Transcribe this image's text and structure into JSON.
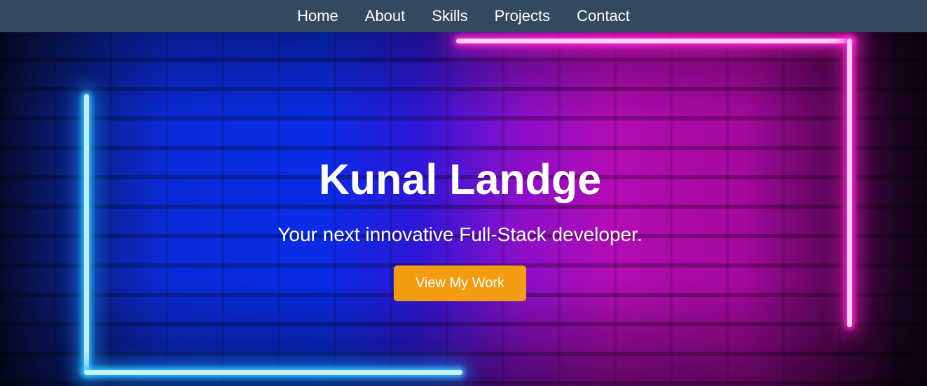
{
  "nav": {
    "items": [
      {
        "label": "Home"
      },
      {
        "label": "About"
      },
      {
        "label": "Skills"
      },
      {
        "label": "Projects"
      },
      {
        "label": "Contact"
      }
    ]
  },
  "hero": {
    "title": "Kunal Landge",
    "subtitle": "Your next innovative Full-Stack developer.",
    "cta_label": "View My Work"
  },
  "colors": {
    "navbar_bg": "#34495e",
    "accent": "#f39c12",
    "neon_blue": "#33c7ff",
    "neon_pink": "#ff2bd6"
  }
}
